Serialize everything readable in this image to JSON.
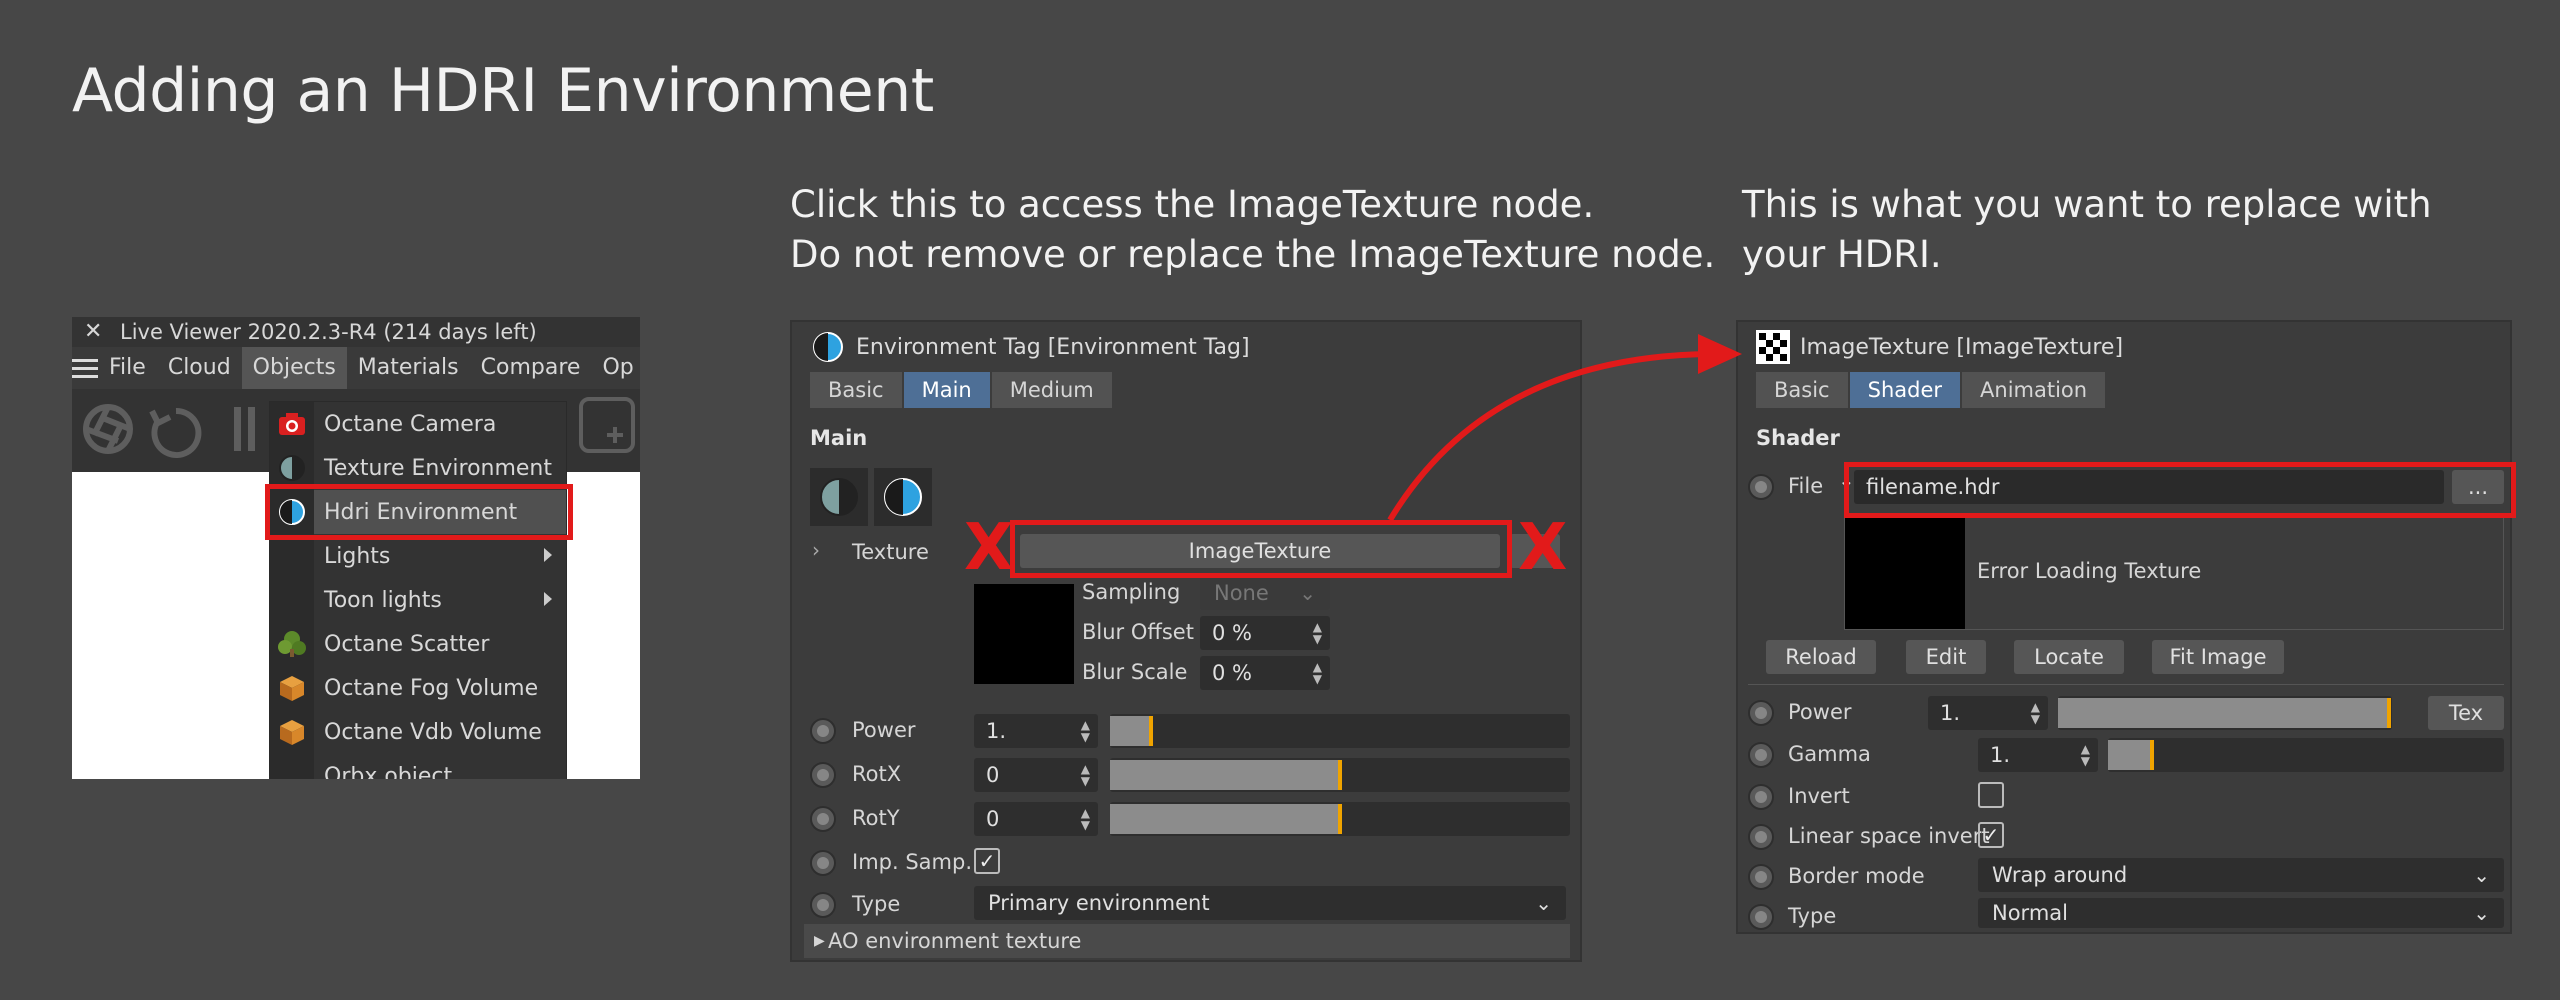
{
  "page": {
    "title": "Adding an HDRI Environment",
    "caption_middle_line1": "Click this to access the ImageTexture node.",
    "caption_middle_line2": "Do not remove or replace the ImageTexture node.",
    "caption_right_line1": "This is what you want to replace with",
    "caption_right_line2": "your HDRI."
  },
  "live_viewer": {
    "title": "Live Viewer 2020.2.3-R4 (214 days left)",
    "close_glyph": "✕",
    "menu": [
      "File",
      "Cloud",
      "Objects",
      "Materials",
      "Compare",
      "Op"
    ],
    "active_menu": "Objects",
    "dropdown_items": [
      {
        "label": "Octane Camera",
        "icon": "camera-icon"
      },
      {
        "label": "Texture Environment",
        "icon": "environment-icon"
      },
      {
        "label": "Hdri Environment",
        "icon": "environment-icon",
        "highlight": true
      },
      {
        "label": "Lights",
        "icon": "",
        "submenu": true
      },
      {
        "label": "Toon lights",
        "icon": "",
        "submenu": true
      },
      {
        "label": "Octane Scatter",
        "icon": "scatter-icon"
      },
      {
        "label": "Octane Fog Volume",
        "icon": "volume-icon"
      },
      {
        "label": "Octane Vdb Volume",
        "icon": "volume-icon"
      },
      {
        "label": "Orbx object",
        "icon": ""
      }
    ]
  },
  "env_tag": {
    "title": "Environment Tag [Environment Tag]",
    "tabs": [
      "Basic",
      "Main",
      "Medium"
    ],
    "active_tab": "Main",
    "section": "Main",
    "texture_label": "Texture",
    "texture_button": "ImageTexture",
    "sampling_label": "Sampling",
    "sampling_value": "None",
    "blur_offset_label": "Blur Offset",
    "blur_offset_value": "0 %",
    "blur_scale_label": "Blur Scale",
    "blur_scale_value": "0 %",
    "x_mark": "X",
    "rows": [
      {
        "label": "Power",
        "value": "1.",
        "fill": 0.09
      },
      {
        "label": "RotX",
        "value": "0",
        "fill": 0.5
      },
      {
        "label": "RotY",
        "value": "0",
        "fill": 0.5
      }
    ],
    "imp_samp_label": "Imp. Samp.",
    "imp_samp_checked": true,
    "type_label": "Type",
    "type_value": "Primary environment",
    "ao_label": "AO environment texture"
  },
  "image_texture": {
    "title": "ImageTexture [ImageTexture]",
    "tabs": [
      "Basic",
      "Shader",
      "Animation"
    ],
    "active_tab": "Shader",
    "section": "Shader",
    "file_label": "File",
    "file_value": "filename.hdr",
    "browse_label": "...",
    "error_text": "Error Loading Texture",
    "buttons": [
      "Reload",
      "Edit",
      "Locate",
      "Fit Image"
    ],
    "power_label": "Power",
    "power_value": "1.",
    "power_fill": 0.99,
    "tex_button": "Tex",
    "gamma_label": "Gamma",
    "gamma_value": "1.",
    "gamma_fill": 0.11,
    "invert_label": "Invert",
    "invert_checked": false,
    "linear_label": "Linear space invert",
    "linear_checked": true,
    "border_label": "Border mode",
    "border_value": "Wrap around",
    "type_label": "Type",
    "type_value": "Normal"
  },
  "colors": {
    "background": "#474747",
    "accent_blue": "#4e6f96",
    "highlight_red": "#e21a1a",
    "slider_mark": "#f0a400"
  }
}
